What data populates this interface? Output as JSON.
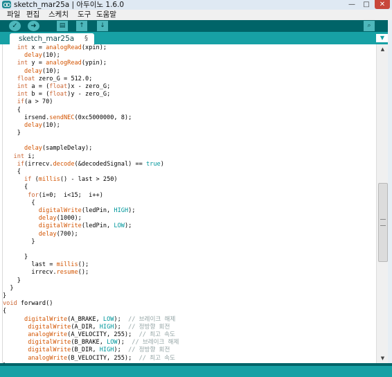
{
  "window": {
    "title": "sketch_mar25a | 아두이노 1.6.0",
    "controls": [
      "—",
      "□",
      "✕"
    ]
  },
  "menu": [
    "파일",
    "편집",
    "스케치",
    "도구",
    "도움말"
  ],
  "toolbar": {
    "verify": "✓",
    "upload": "➜",
    "new": "▤",
    "open": "↑",
    "save": "↓",
    "serial_monitor": "⌕"
  },
  "tab": {
    "label": "sketch_mar25a",
    "modified": "§",
    "menu": "▼"
  },
  "scrollbar": {
    "up": "▲",
    "down": "▼"
  },
  "code": [
    [
      [
        "    ",
        ""
      ],
      [
        "int",
        "kt"
      ],
      [
        " x = ",
        ""
      ],
      [
        "analogRead",
        "kf"
      ],
      [
        "(xpin);",
        ""
      ]
    ],
    [
      [
        "      ",
        ""
      ],
      [
        "delay",
        "kf"
      ],
      [
        "(10);",
        ""
      ]
    ],
    [
      [
        "    ",
        ""
      ],
      [
        "int",
        "kt"
      ],
      [
        " y = ",
        ""
      ],
      [
        "analogRead",
        "kf"
      ],
      [
        "(ypin);",
        ""
      ]
    ],
    [
      [
        "      ",
        ""
      ],
      [
        "delay",
        "kf"
      ],
      [
        "(10);",
        ""
      ]
    ],
    [
      [
        "    ",
        ""
      ],
      [
        "float",
        "kt"
      ],
      [
        " zero_G = 512.0;",
        ""
      ]
    ],
    [
      [
        "    ",
        ""
      ],
      [
        "int",
        "kt"
      ],
      [
        " a = (",
        ""
      ],
      [
        "float",
        "kt"
      ],
      [
        ")x - zero_G;",
        ""
      ]
    ],
    [
      [
        "    ",
        ""
      ],
      [
        "int",
        "kt"
      ],
      [
        " b = (",
        ""
      ],
      [
        "float",
        "kt"
      ],
      [
        ")y - zero_G;",
        ""
      ]
    ],
    [
      [
        "    ",
        ""
      ],
      [
        "if",
        "kt"
      ],
      [
        "(a > 70)",
        ""
      ]
    ],
    [
      [
        "    {",
        ""
      ]
    ],
    [
      [
        "      irsend.",
        ""
      ],
      [
        "sendNEC",
        "kf"
      ],
      [
        "(0xc5000000, 8);",
        ""
      ]
    ],
    [
      [
        "      ",
        ""
      ],
      [
        "delay",
        "kf"
      ],
      [
        "(10);",
        ""
      ]
    ],
    [
      [
        "    }",
        ""
      ]
    ],
    [
      [
        "",
        ""
      ]
    ],
    [
      [
        "      ",
        ""
      ],
      [
        "delay",
        "kf"
      ],
      [
        "(sampleDelay);",
        ""
      ]
    ],
    [
      [
        "   ",
        ""
      ],
      [
        "int",
        "kt"
      ],
      [
        " i;",
        ""
      ]
    ],
    [
      [
        "    ",
        ""
      ],
      [
        "if",
        "kt"
      ],
      [
        "(irrecv.",
        ""
      ],
      [
        "decode",
        "kf"
      ],
      [
        "(&decodedSignal) == ",
        ""
      ],
      [
        "true",
        "kc"
      ],
      [
        ")",
        ""
      ]
    ],
    [
      [
        "    {",
        ""
      ]
    ],
    [
      [
        "      ",
        ""
      ],
      [
        "if",
        "kt"
      ],
      [
        " (",
        ""
      ],
      [
        "millis",
        "kf"
      ],
      [
        "() - last > 250)",
        ""
      ]
    ],
    [
      [
        "      {",
        ""
      ]
    ],
    [
      [
        "       ",
        ""
      ],
      [
        "for",
        "kt"
      ],
      [
        "(i=0;  i<15;  i++)",
        ""
      ]
    ],
    [
      [
        "        {",
        ""
      ]
    ],
    [
      [
        "          ",
        ""
      ],
      [
        "digitalWrite",
        "kf"
      ],
      [
        "(ledPin, ",
        ""
      ],
      [
        "HIGH",
        "kc"
      ],
      [
        ");",
        ""
      ]
    ],
    [
      [
        "          ",
        ""
      ],
      [
        "delay",
        "kf"
      ],
      [
        "(1000);",
        ""
      ]
    ],
    [
      [
        "          ",
        ""
      ],
      [
        "digitalWrite",
        "kf"
      ],
      [
        "(ledPin, ",
        ""
      ],
      [
        "LOW",
        "kc"
      ],
      [
        ");",
        ""
      ]
    ],
    [
      [
        "          ",
        ""
      ],
      [
        "delay",
        "kf"
      ],
      [
        "(700);",
        ""
      ]
    ],
    [
      [
        "        }",
        ""
      ]
    ],
    [
      [
        "",
        ""
      ]
    ],
    [
      [
        "      }",
        ""
      ]
    ],
    [
      [
        "        last = ",
        ""
      ],
      [
        "millis",
        "kf"
      ],
      [
        "();",
        ""
      ]
    ],
    [
      [
        "        irrecv.",
        ""
      ],
      [
        "resume",
        "kf"
      ],
      [
        "();",
        ""
      ]
    ],
    [
      [
        "    }",
        ""
      ]
    ],
    [
      [
        "  }",
        ""
      ]
    ],
    [
      [
        "}",
        ""
      ]
    ],
    [
      [
        "",
        ""
      ],
      [
        "void",
        "kt"
      ],
      [
        " forward()",
        ""
      ]
    ],
    [
      [
        "{",
        ""
      ]
    ],
    [
      [
        "      ",
        ""
      ],
      [
        "digitalWrite",
        "kf"
      ],
      [
        "(A_BRAKE, ",
        ""
      ],
      [
        "LOW",
        "kc"
      ],
      [
        ");  ",
        ""
      ],
      [
        "// 브레이크 해제",
        "cm"
      ]
    ],
    [
      [
        "       ",
        ""
      ],
      [
        "digitalWrite",
        "kf"
      ],
      [
        "(A_DIR, ",
        ""
      ],
      [
        "HIGH",
        "kc"
      ],
      [
        ");  ",
        ""
      ],
      [
        "// 정방향 회전",
        "cm"
      ]
    ],
    [
      [
        "       ",
        ""
      ],
      [
        "analogWrite",
        "kf"
      ],
      [
        "(A_VELOCITY, 255);  ",
        ""
      ],
      [
        "// 최고 속도",
        "cm"
      ]
    ],
    [
      [
        "       ",
        ""
      ],
      [
        "digitalWrite",
        "kf"
      ],
      [
        "(B_BRAKE, ",
        ""
      ],
      [
        "LOW",
        "kc"
      ],
      [
        ");  ",
        ""
      ],
      [
        "// 브레이크 해제",
        "cm"
      ]
    ],
    [
      [
        "       ",
        ""
      ],
      [
        "digitalWrite",
        "kf"
      ],
      [
        "(B_DIR, ",
        ""
      ],
      [
        "HIGH",
        "kc"
      ],
      [
        ");  ",
        ""
      ],
      [
        "// 정방향 회전",
        "cm"
      ]
    ],
    [
      [
        "       ",
        ""
      ],
      [
        "analogWrite",
        "kf"
      ],
      [
        "(B_VELOCITY, 255);  ",
        ""
      ],
      [
        "// 최고 속도",
        "cm"
      ]
    ],
    [
      [
        "}",
        ""
      ]
    ]
  ]
}
